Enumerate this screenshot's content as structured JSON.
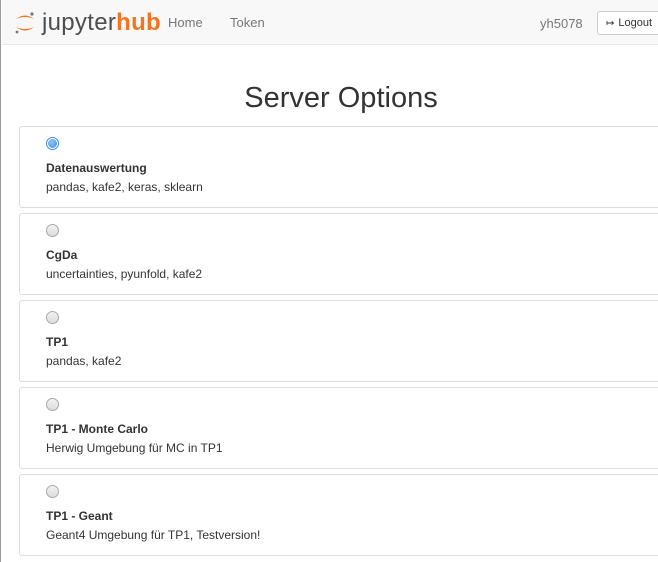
{
  "navbar": {
    "brand_prefix": "jupyter",
    "brand_suffix": "hub",
    "home_label": "Home",
    "token_label": "Token",
    "username": "yh5078",
    "logout_label": "Logout",
    "logout_icon": "sign-out-icon"
  },
  "page": {
    "title": "Server Options"
  },
  "colors": {
    "brand_orange": "#f37524",
    "radio_checked": "#3a8ee6"
  },
  "options": [
    {
      "name": "Datenauswertung",
      "description": "pandas, kafe2, keras, sklearn",
      "selected": true
    },
    {
      "name": "CgDa",
      "description": "uncertainties, pyunfold, kafe2",
      "selected": false
    },
    {
      "name": "TP1",
      "description": "pandas, kafe2",
      "selected": false
    },
    {
      "name": "TP1 - Monte Carlo",
      "description": "Herwig Umgebung für MC in TP1",
      "selected": false
    },
    {
      "name": "TP1 - Geant",
      "description": "Geant4 Umgebung für TP1, Testversion!",
      "selected": false
    }
  ]
}
